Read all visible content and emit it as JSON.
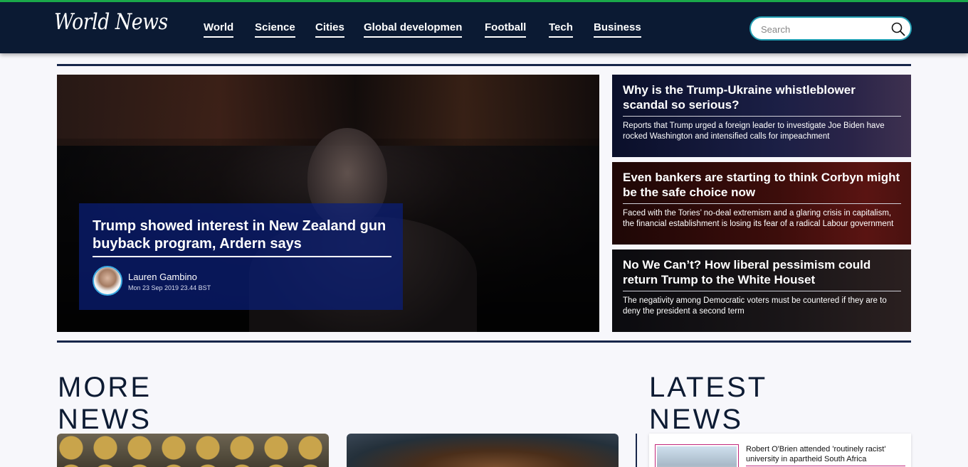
{
  "header": {
    "logo": "World News",
    "nav": [
      "World",
      "Science",
      "Cities",
      "Global developmen",
      "Football",
      "Tech",
      "Business"
    ],
    "search_placeholder": "Search"
  },
  "hero": {
    "headline": "Trump showed interest in New Zealand gun buyback program, Ardern says",
    "author": "Lauren Gambino",
    "date": "Mon 23 Sep 2019 23.44 BST"
  },
  "side_stories": [
    {
      "headline": "Why is the Trump-Ukraine whistleblower scandal so serious?",
      "summary": "Reports that Trump urged a foreign leader to investigate Joe Biden have rocked Washington and intensified calls for impeachment"
    },
    {
      "headline": "Even bankers are starting to think Corbyn might be the safe choice now",
      "summary": "Faced with the Tories’ no-deal extremism and a glaring crisis in capitalism, the financial establishment is losing its fear of a radical Labour government"
    },
    {
      "headline": "No We Can’t? How liberal pessimism could return Trump to the White Houset",
      "summary": "The negativity among Democratic voters must be countered if they are to deny the president a second term"
    }
  ],
  "sections": {
    "more_news": "MORE NEWS",
    "latest_news": "LATEST NEWS"
  },
  "latest": [
    {
      "text": "Robert O'Brien attended 'routinely racist' university in apartheid South Africa"
    }
  ],
  "colors": {
    "header_bg": "#0b1a33",
    "accent_green": "#1aa84a",
    "search_border": "#23a0b4",
    "latest_accent": "#c0267a"
  }
}
